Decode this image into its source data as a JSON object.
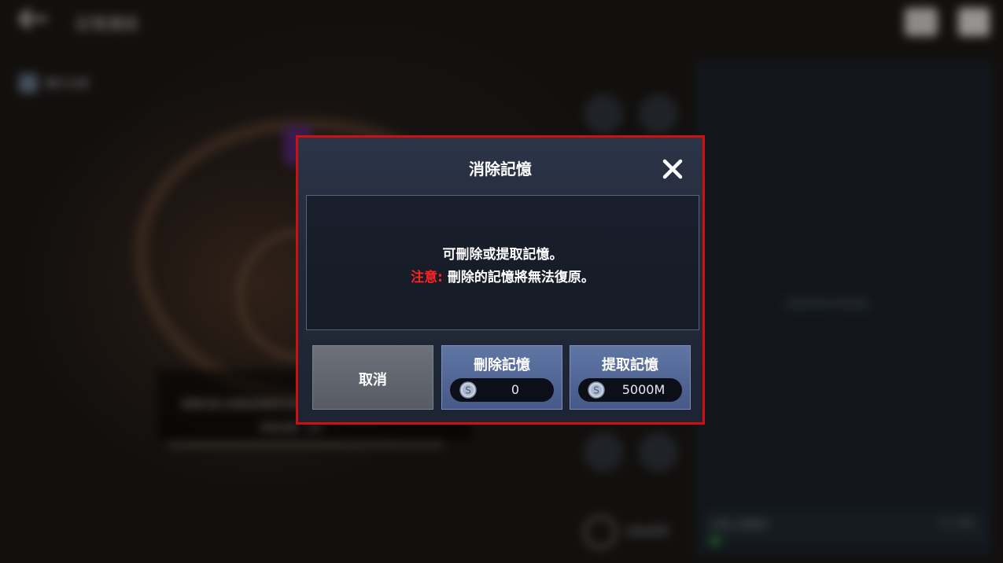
{
  "background": {
    "header": {
      "title": "記憶連結"
    },
    "filter": {
      "label": "顯示全部"
    },
    "banner": {
      "line1": "選擇記憶以查看詳細資訊及其說明",
      "line2": "持有記憶：0/0"
    },
    "right_panel": {
      "empty_text": "沒有持有中的記憶。",
      "footer_text": "記憶上限擴充",
      "footer_count": "0 / 500"
    },
    "auto_select": {
      "label": "自動選擇"
    }
  },
  "dialog": {
    "title": "消除記憶",
    "message": {
      "line1": "可刪除或提取記憶。",
      "warning_label": "注意:",
      "warning_text": " 刪除的記憶將無法復原。"
    },
    "buttons": {
      "cancel": {
        "label": "取消"
      },
      "delete": {
        "label": "刪除記憶",
        "cost": "0",
        "currency_icon": "silver-coin-icon"
      },
      "extract": {
        "label": "提取記憶",
        "cost": "5000M",
        "currency_icon": "silver-coin-icon"
      }
    }
  },
  "colors": {
    "dialog_highlight": "#d01010",
    "warning": "#ff2222",
    "button_blue": "#4e6394",
    "button_gray": "#60656e"
  }
}
